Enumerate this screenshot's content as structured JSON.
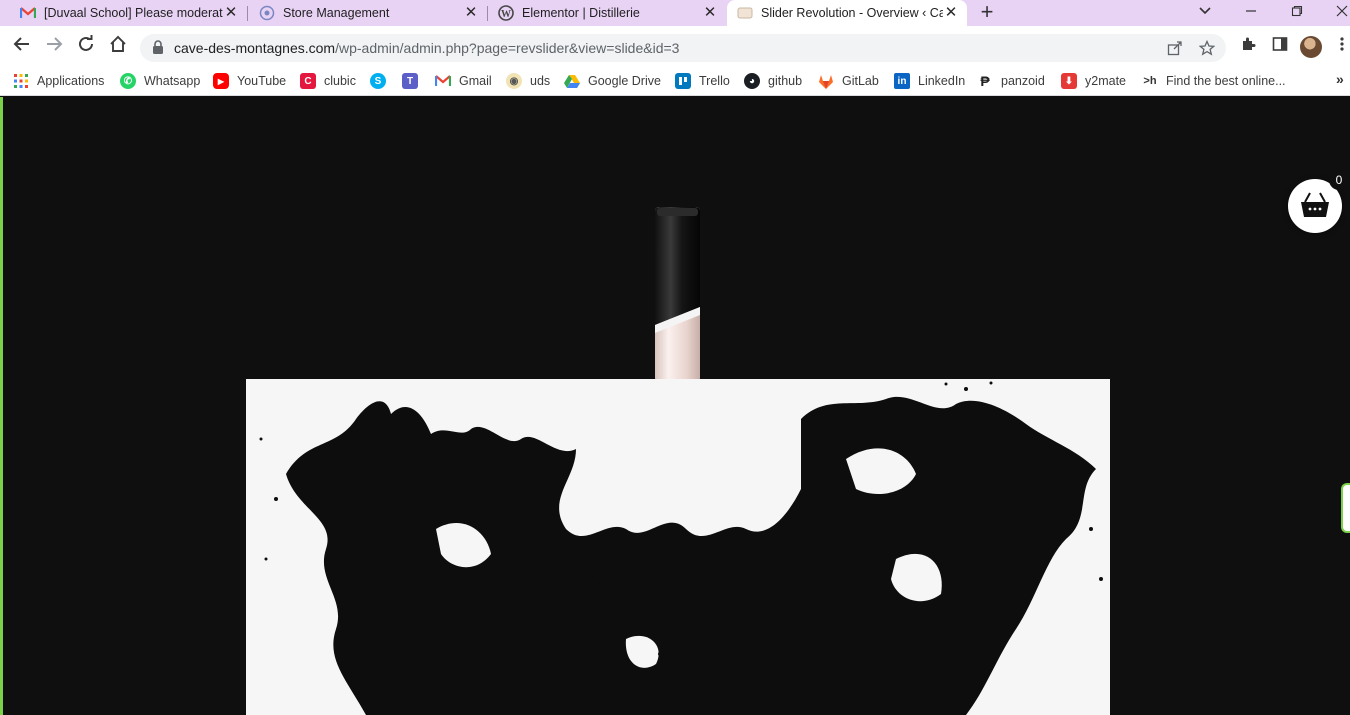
{
  "browser": {
    "tabs": [
      {
        "title": "[Duvaal School] Please moderate",
        "icon": "gmail-icon",
        "active": false
      },
      {
        "title": "Store Management",
        "icon": "store-icon",
        "active": false
      },
      {
        "title": "Elementor | Distillerie",
        "icon": "wordpress-icon",
        "active": false
      },
      {
        "title": "Slider Revolution - Overview ‹ Ca",
        "icon": "slider-revolution-icon",
        "active": true
      }
    ],
    "new_tab": "+",
    "address": {
      "host": "cave-des-montagnes.com",
      "path": "/wp-admin/admin.php?page=revslider&view=slide&id=3"
    },
    "bookmarks": [
      {
        "label": "Applications",
        "icon": "apps-grid-icon"
      },
      {
        "label": "Whatsapp",
        "icon": "whatsapp-icon"
      },
      {
        "label": "YouTube",
        "icon": "youtube-icon"
      },
      {
        "label": "clubic",
        "icon": "clubic-icon"
      },
      {
        "label": "",
        "icon": "skype-icon"
      },
      {
        "label": "",
        "icon": "teams-icon"
      },
      {
        "label": "Gmail",
        "icon": "gmail-icon"
      },
      {
        "label": "uds",
        "icon": "uds-icon"
      },
      {
        "label": "Google Drive",
        "icon": "google-drive-icon"
      },
      {
        "label": "Trello",
        "icon": "trello-icon"
      },
      {
        "label": "github",
        "icon": "github-icon"
      },
      {
        "label": "GitLab",
        "icon": "gitlab-icon"
      },
      {
        "label": "LinkedIn",
        "icon": "linkedin-icon"
      },
      {
        "label": "panzoid",
        "icon": "panzoid-icon"
      },
      {
        "label": "y2mate",
        "icon": "y2mate-icon"
      },
      {
        "label": "Find the best online...",
        "icon": "hackr-icon"
      }
    ],
    "bookmarks_overflow": "»"
  },
  "page": {
    "cart_count": "0",
    "colors": {
      "background": "#0f0f0f",
      "splash_panel": "#f6f6f6",
      "accent_border": "#7bd148"
    }
  }
}
